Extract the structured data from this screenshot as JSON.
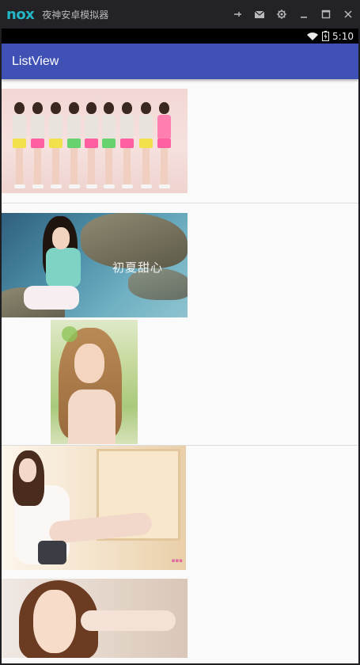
{
  "window": {
    "logo": "nox",
    "title": "夜神安卓模拟器",
    "icons": [
      "pin-icon",
      "message-icon",
      "settings-icon",
      "minimize-icon",
      "maximize-icon",
      "close-icon"
    ]
  },
  "statusbar": {
    "time": "5:10",
    "icons": [
      "wifi-icon",
      "battery-charging-icon"
    ]
  },
  "appbar": {
    "title": "ListView"
  },
  "list": {
    "items": [
      {
        "type": "image",
        "subject": "group-photo"
      },
      {
        "type": "image",
        "subject": "sea-rock-photo",
        "overlay_text": "初夏甜心"
      },
      {
        "type": "image",
        "subject": "portrait-photo"
      },
      {
        "type": "image",
        "subject": "window-photo"
      },
      {
        "type": "image",
        "subject": "closeup-photo"
      }
    ]
  },
  "colors": {
    "titlebar": "#232327",
    "accent_nox": "#23b6c7",
    "appbar": "#3f51b5",
    "screen_bg": "#fafafa",
    "statusbar": "#000000"
  }
}
